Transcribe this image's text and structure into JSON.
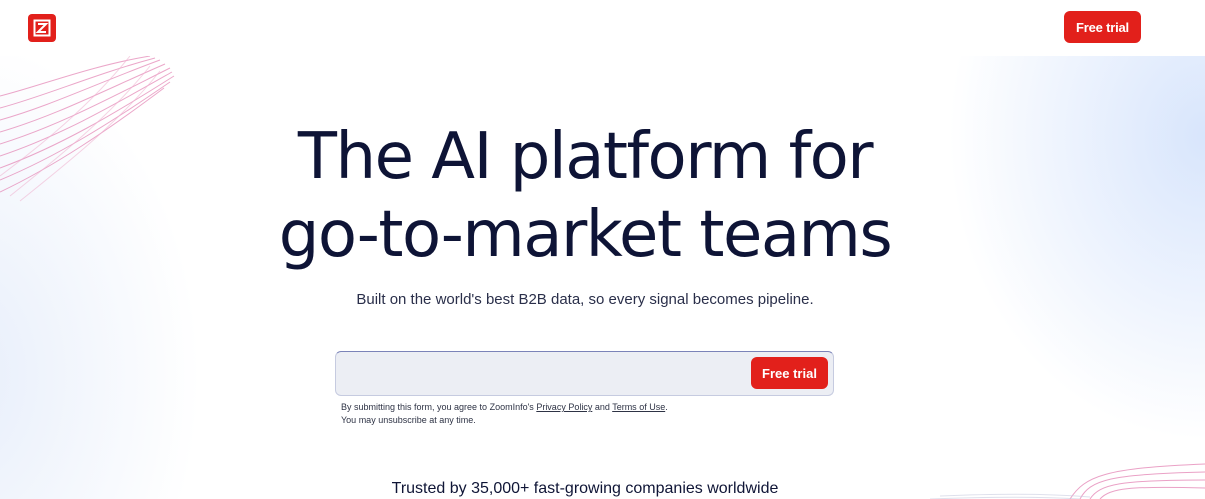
{
  "header": {
    "logo_icon": "zoominfo-logo-icon",
    "cta_label": "Free trial"
  },
  "hero": {
    "title_line1": "The AI platform for",
    "title_line2": "go-to-market teams",
    "subtitle": "Built on the world's best B2B data, so every signal becomes pipeline."
  },
  "form": {
    "email_value": "",
    "email_placeholder": "",
    "submit_label": "Free trial",
    "disclaimer_pre": "By submitting this form, you agree to ZoomInfo's ",
    "privacy_link": "Privacy Policy",
    "and_text": " and ",
    "terms_link": "Terms of Use",
    "period": ".",
    "unsubscribe": "You may unsubscribe at any time."
  },
  "trusted": {
    "text": "Trusted by 35,000+ fast-growing companies worldwide"
  },
  "colors": {
    "brand_red": "#e2201b",
    "text_dark": "#0e1436"
  }
}
